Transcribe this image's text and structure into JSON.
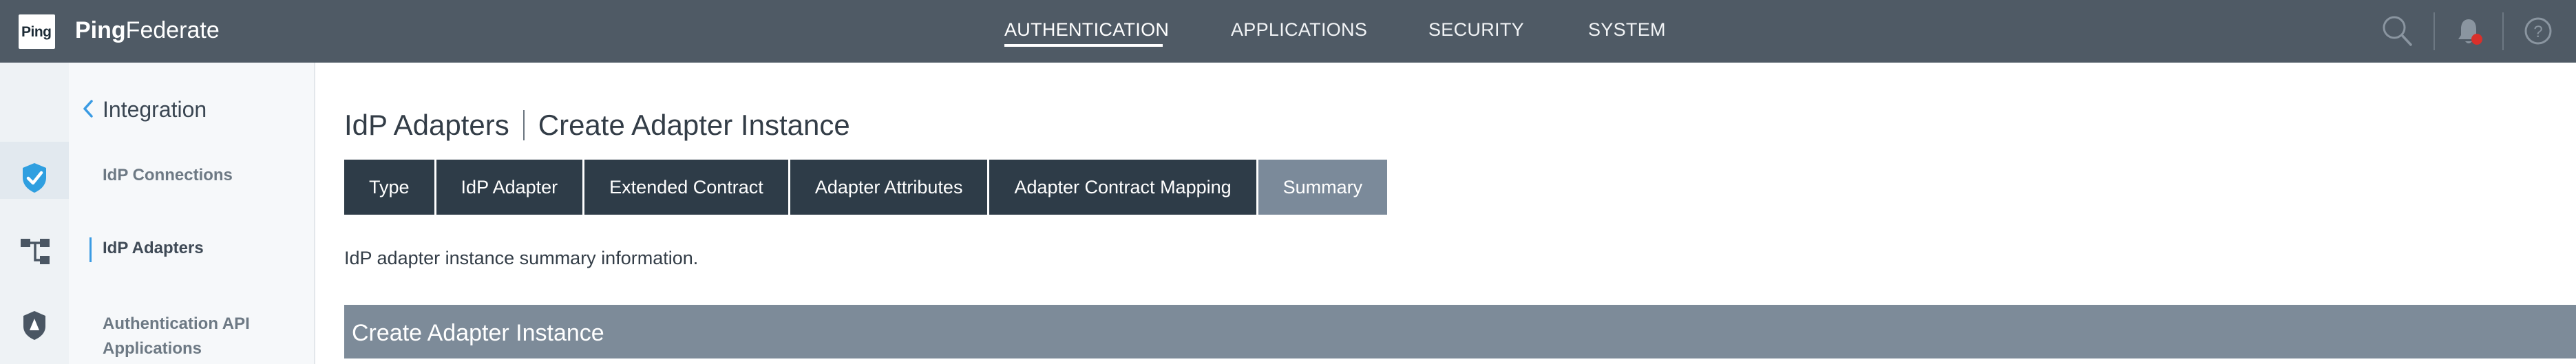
{
  "brand": {
    "logo_text": "Ping",
    "name_bold": "Ping",
    "name_rest": "Federate"
  },
  "top_nav": [
    {
      "label": "AUTHENTICATION",
      "active": true
    },
    {
      "label": "APPLICATIONS",
      "active": false
    },
    {
      "label": "SECURITY",
      "active": false
    },
    {
      "label": "SYSTEM",
      "active": false
    }
  ],
  "top_icons": [
    "search-icon",
    "notification-bell-icon",
    "help-icon"
  ],
  "colors": {
    "topbar": "#4f5a65",
    "tab_dark": "#2e3c48",
    "tab_current": "#7b8a9a",
    "section_bar": "#7d8b99",
    "active_accent": "#3a9be3",
    "notification_dot": "#d9302b",
    "shield": "#2f9fe0"
  },
  "sidebar": {
    "back_label": "Integration",
    "items": [
      {
        "label": "IdP Connections",
        "active": false
      },
      {
        "label": "IdP Adapters",
        "active": true
      },
      {
        "label": "Authentication API",
        "label_line2": "Applications",
        "active": false
      }
    ]
  },
  "rail_icons": [
    "shield-check-icon",
    "connections-tree-icon",
    "policy-badge-icon"
  ],
  "page": {
    "title_part1": "IdP Adapters",
    "title_part2": "Create Adapter Instance",
    "tabs": [
      {
        "label": "Type",
        "current": false
      },
      {
        "label": "IdP Adapter",
        "current": false
      },
      {
        "label": "Extended Contract",
        "current": false
      },
      {
        "label": "Adapter Attributes",
        "current": false
      },
      {
        "label": "Adapter Contract Mapping",
        "current": false
      },
      {
        "label": "Summary",
        "current": true
      }
    ],
    "info_text": "IdP adapter instance summary information.",
    "section_title": "Create Adapter Instance"
  }
}
